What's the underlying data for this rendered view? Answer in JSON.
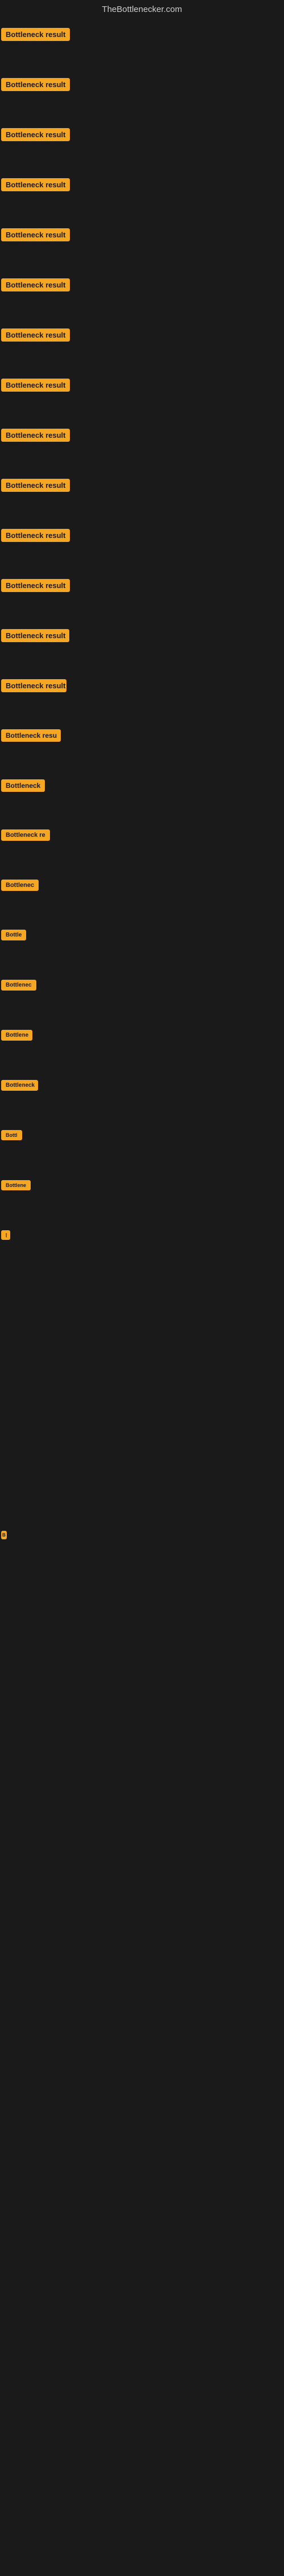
{
  "header": {
    "title": "TheBottlenecker.com"
  },
  "badge_label": "Bottleneck result",
  "rows": [
    {
      "id": 1,
      "visible": true,
      "width_class": "row-1"
    },
    {
      "id": 2,
      "visible": true,
      "width_class": "row-2"
    },
    {
      "id": 3,
      "visible": true,
      "width_class": "row-3"
    },
    {
      "id": 4,
      "visible": true,
      "width_class": "row-4"
    },
    {
      "id": 5,
      "visible": true,
      "width_class": "row-5"
    },
    {
      "id": 6,
      "visible": true,
      "width_class": "row-6"
    },
    {
      "id": 7,
      "visible": true,
      "width_class": "row-7"
    },
    {
      "id": 8,
      "visible": true,
      "width_class": "row-8"
    },
    {
      "id": 9,
      "visible": true,
      "width_class": "row-9"
    },
    {
      "id": 10,
      "visible": true,
      "width_class": "row-10"
    },
    {
      "id": 11,
      "visible": true,
      "width_class": "row-11"
    },
    {
      "id": 12,
      "visible": true,
      "width_class": "row-12"
    },
    {
      "id": 13,
      "visible": true,
      "width_class": "row-13"
    },
    {
      "id": 14,
      "visible": true,
      "width_class": "row-14"
    },
    {
      "id": 15,
      "visible": true,
      "width_class": "row-15"
    },
    {
      "id": 16,
      "visible": true,
      "width_class": "row-16"
    },
    {
      "id": 17,
      "visible": true,
      "width_class": "row-17"
    },
    {
      "id": 18,
      "visible": true,
      "width_class": "row-18"
    },
    {
      "id": 19,
      "visible": true,
      "width_class": "row-19"
    },
    {
      "id": 20,
      "visible": true,
      "width_class": "row-20"
    },
    {
      "id": 21,
      "visible": true,
      "width_class": "row-21"
    },
    {
      "id": 22,
      "visible": true,
      "width_class": "row-22"
    },
    {
      "id": 23,
      "visible": true,
      "width_class": "row-23"
    },
    {
      "id": 24,
      "visible": true,
      "width_class": "row-24"
    },
    {
      "id": 25,
      "visible": true,
      "width_class": "row-25"
    }
  ],
  "blank_rows_count": 12,
  "b_row_label": "B",
  "trailing_blank_rows": 20
}
